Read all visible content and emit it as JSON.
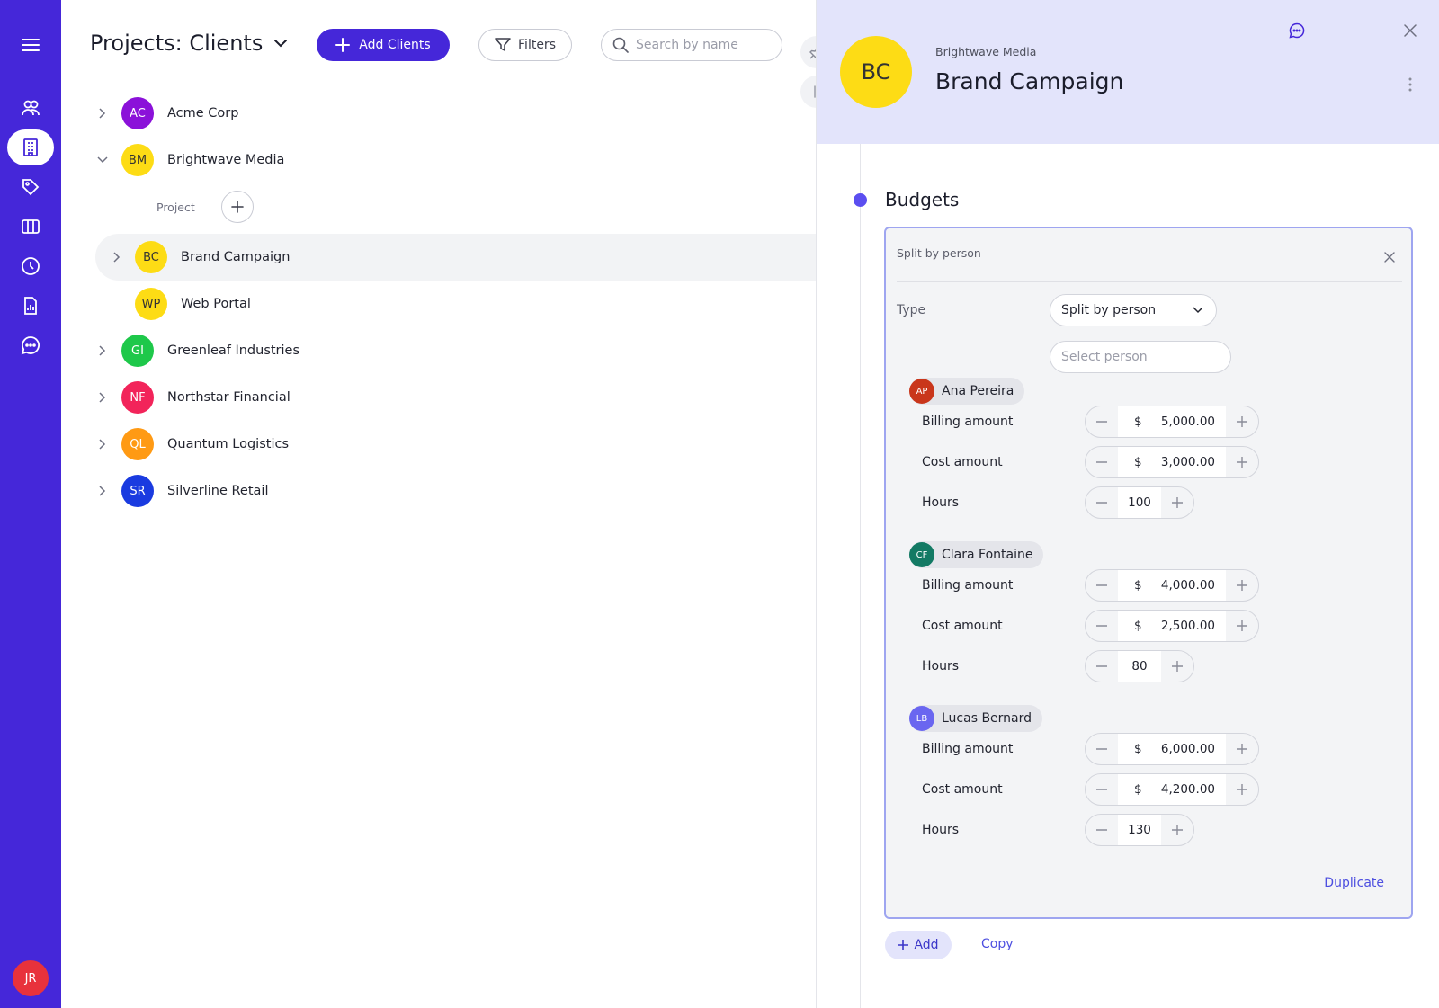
{
  "header": {
    "title": "Projects: Clients",
    "add_label": "Add Clients",
    "filters_label": "Filters",
    "search_placeholder": "Search by name"
  },
  "user": {
    "initials": "JR"
  },
  "clients": [
    {
      "initials": "AC",
      "name": "Acme Corp",
      "color": "#8b11d9"
    },
    {
      "initials": "BM",
      "name": "Brightwave Media",
      "color": "#fddc15"
    },
    {
      "initials": "GI",
      "name": "Greenleaf Industries",
      "color": "#1ec84a"
    },
    {
      "initials": "NF",
      "name": "Northstar Financial",
      "color": "#f2245a"
    },
    {
      "initials": "QL",
      "name": "Quantum Logistics",
      "color": "#ff9a14"
    },
    {
      "initials": "SR",
      "name": "Silverline Retail",
      "color": "#1a3be0"
    }
  ],
  "project_header": {
    "label": "Project"
  },
  "projects": [
    {
      "initials": "BC",
      "name": "Brand Campaign"
    },
    {
      "initials": "WP",
      "name": "Web Portal"
    }
  ],
  "detail": {
    "avatar": "BC",
    "client": "Brightwave Media",
    "title": "Brand Campaign",
    "section": "Budgets",
    "card_title": "Split by person",
    "type_label": "Type",
    "type_value": "Split by person",
    "person_placeholder": "Select person",
    "currency": "$",
    "people": [
      {
        "initials": "AP",
        "name": "Ana Pereira",
        "color": "#c9361b",
        "billing_label": "Billing amount",
        "billing": "5,000.00",
        "cost_label": "Cost amount",
        "cost": "3,000.00",
        "hours_label": "Hours",
        "hours": "100"
      },
      {
        "initials": "CF",
        "name": "Clara Fontaine",
        "color": "#137a64",
        "billing_label": "Billing amount",
        "billing": "4,000.00",
        "cost_label": "Cost amount",
        "cost": "2,500.00",
        "hours_label": "Hours",
        "hours": "80"
      },
      {
        "initials": "LB",
        "name": "Lucas Bernard",
        "color": "#6a66f0",
        "billing_label": "Billing amount",
        "billing": "6,000.00",
        "cost_label": "Cost amount",
        "cost": "4,200.00",
        "hours_label": "Hours",
        "hours": "130"
      }
    ],
    "duplicate_label": "Duplicate",
    "add_label": "Add",
    "copy_label": "Copy"
  },
  "colors": {
    "accent": "#4527d9",
    "panel_header": "#e3e4fb",
    "link": "#4d4fe0"
  }
}
